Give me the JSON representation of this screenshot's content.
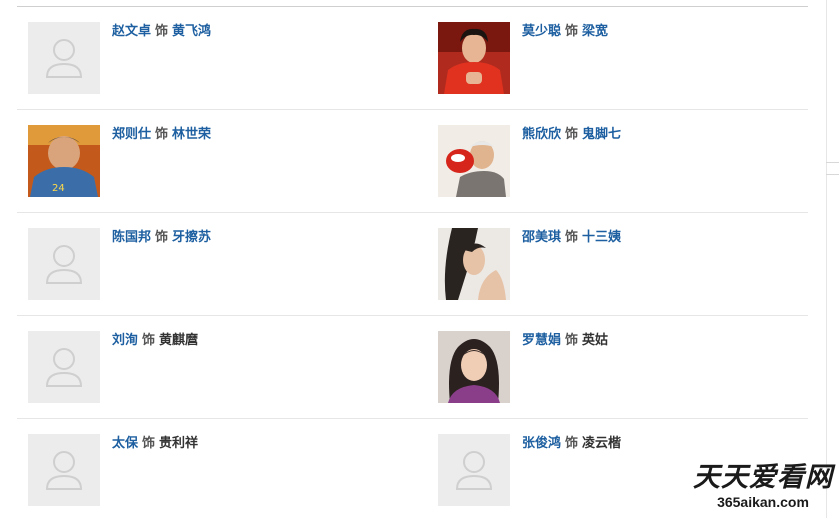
{
  "connector": "饰",
  "cast": [
    {
      "actor": "赵文卓",
      "role": "黄飞鸿",
      "role_link": true,
      "photo": "placeholder"
    },
    {
      "actor": "莫少聪",
      "role": "梁宽",
      "role_link": true,
      "photo": "man-red-jacket"
    },
    {
      "actor": "郑则仕",
      "role": "林世荣",
      "role_link": true,
      "photo": "man-blue-sweater"
    },
    {
      "actor": "熊欣欣",
      "role": "鬼脚七",
      "role_link": true,
      "photo": "man-red-toy"
    },
    {
      "actor": "陈国邦",
      "role": "牙擦苏",
      "role_link": true,
      "photo": "placeholder"
    },
    {
      "actor": "邵美琪",
      "role": "十三姨",
      "role_link": true,
      "photo": "woman-dark-hair"
    },
    {
      "actor": "刘洵",
      "role": "黄麒麿",
      "role_link": false,
      "photo": "placeholder"
    },
    {
      "actor": "罗慧娟",
      "role": "英姑",
      "role_link": false,
      "photo": "woman-purple-top"
    },
    {
      "actor": "太保",
      "role": "贵利祥",
      "role_link": false,
      "photo": "placeholder"
    },
    {
      "actor": "张俊鸿",
      "role": "凌云楷",
      "role_link": false,
      "photo": "placeholder"
    }
  ],
  "watermark": {
    "title": "天天爱看网",
    "domain": "365aikan.com"
  },
  "colors": {
    "link": "#1d5fa0",
    "role_plain": "#333333",
    "placeholder_bg": "#ececec",
    "divider": "#e6e6e6"
  }
}
